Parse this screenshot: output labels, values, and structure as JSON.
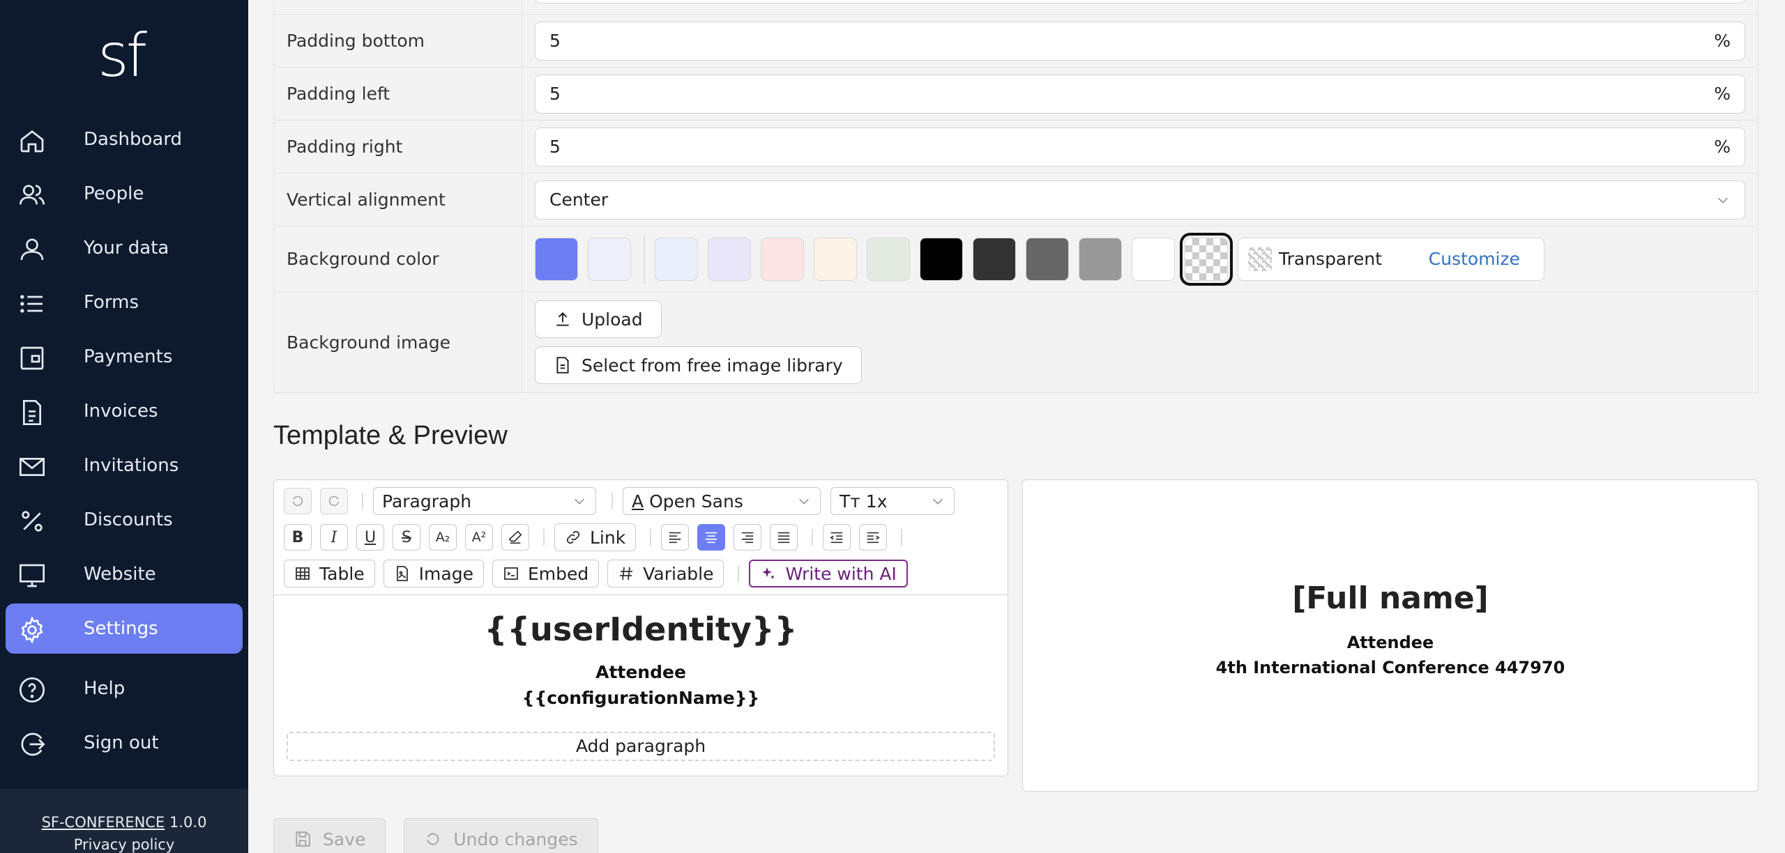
{
  "app": {
    "logo": "sf"
  },
  "sidebar": {
    "items": [
      {
        "label": "Dashboard",
        "icon": "home-icon"
      },
      {
        "label": "People",
        "icon": "people-icon"
      },
      {
        "label": "Your data",
        "icon": "user-icon"
      },
      {
        "label": "Forms",
        "icon": "list-icon"
      },
      {
        "label": "Payments",
        "icon": "wallet-icon"
      },
      {
        "label": "Invoices",
        "icon": "document-icon"
      },
      {
        "label": "Invitations",
        "icon": "mail-icon"
      },
      {
        "label": "Discounts",
        "icon": "percent-icon"
      },
      {
        "label": "Website",
        "icon": "monitor-icon"
      },
      {
        "label": "Settings",
        "icon": "gear-icon",
        "active": true
      },
      {
        "label": "Help",
        "icon": "help-icon"
      },
      {
        "label": "Sign out",
        "icon": "sign-out-icon"
      }
    ],
    "footer": {
      "product": "SF-CONFERENCE",
      "version": "1.0.0",
      "privacy": "Privacy policy"
    }
  },
  "props": {
    "padding_bottom": {
      "label": "Padding bottom",
      "value": "5",
      "unit": "%"
    },
    "padding_left": {
      "label": "Padding left",
      "value": "5",
      "unit": "%"
    },
    "padding_right": {
      "label": "Padding right",
      "value": "5",
      "unit": "%"
    },
    "vertical_alignment": {
      "label": "Vertical alignment",
      "value": "Center"
    },
    "background_color": {
      "label": "Background color",
      "swatches": [
        "#6c7ef2",
        "#eeeff9",
        "#e9f0fb",
        "#e9e6fa",
        "#fbe4e4",
        "#fdf3e6",
        "#e3ebe1",
        "#000000",
        "#333333",
        "#666666",
        "#999999",
        "#ffffff",
        "transparent"
      ],
      "selected": "Transparent",
      "customize": "Customize"
    },
    "background_image": {
      "label": "Background image",
      "upload": "Upload",
      "library": "Select from free image library"
    }
  },
  "section": {
    "title": "Template & Preview"
  },
  "editor": {
    "block_style": "Paragraph",
    "font": "Open Sans",
    "size": "1x",
    "link_label": "Link",
    "table_label": "Table",
    "image_label": "Image",
    "embed_label": "Embed",
    "variable_label": "Variable",
    "ai_label": "Write with AI",
    "content": {
      "heading": "{{userIdentity}}",
      "line1": "Attendee",
      "line2": "{{configurationName}}",
      "add": "Add paragraph"
    }
  },
  "preview": {
    "heading": "[Full name]",
    "line1": "Attendee",
    "line2": "4th International Conference 447970"
  },
  "actions": {
    "save": "Save",
    "undo": "Undo changes"
  }
}
